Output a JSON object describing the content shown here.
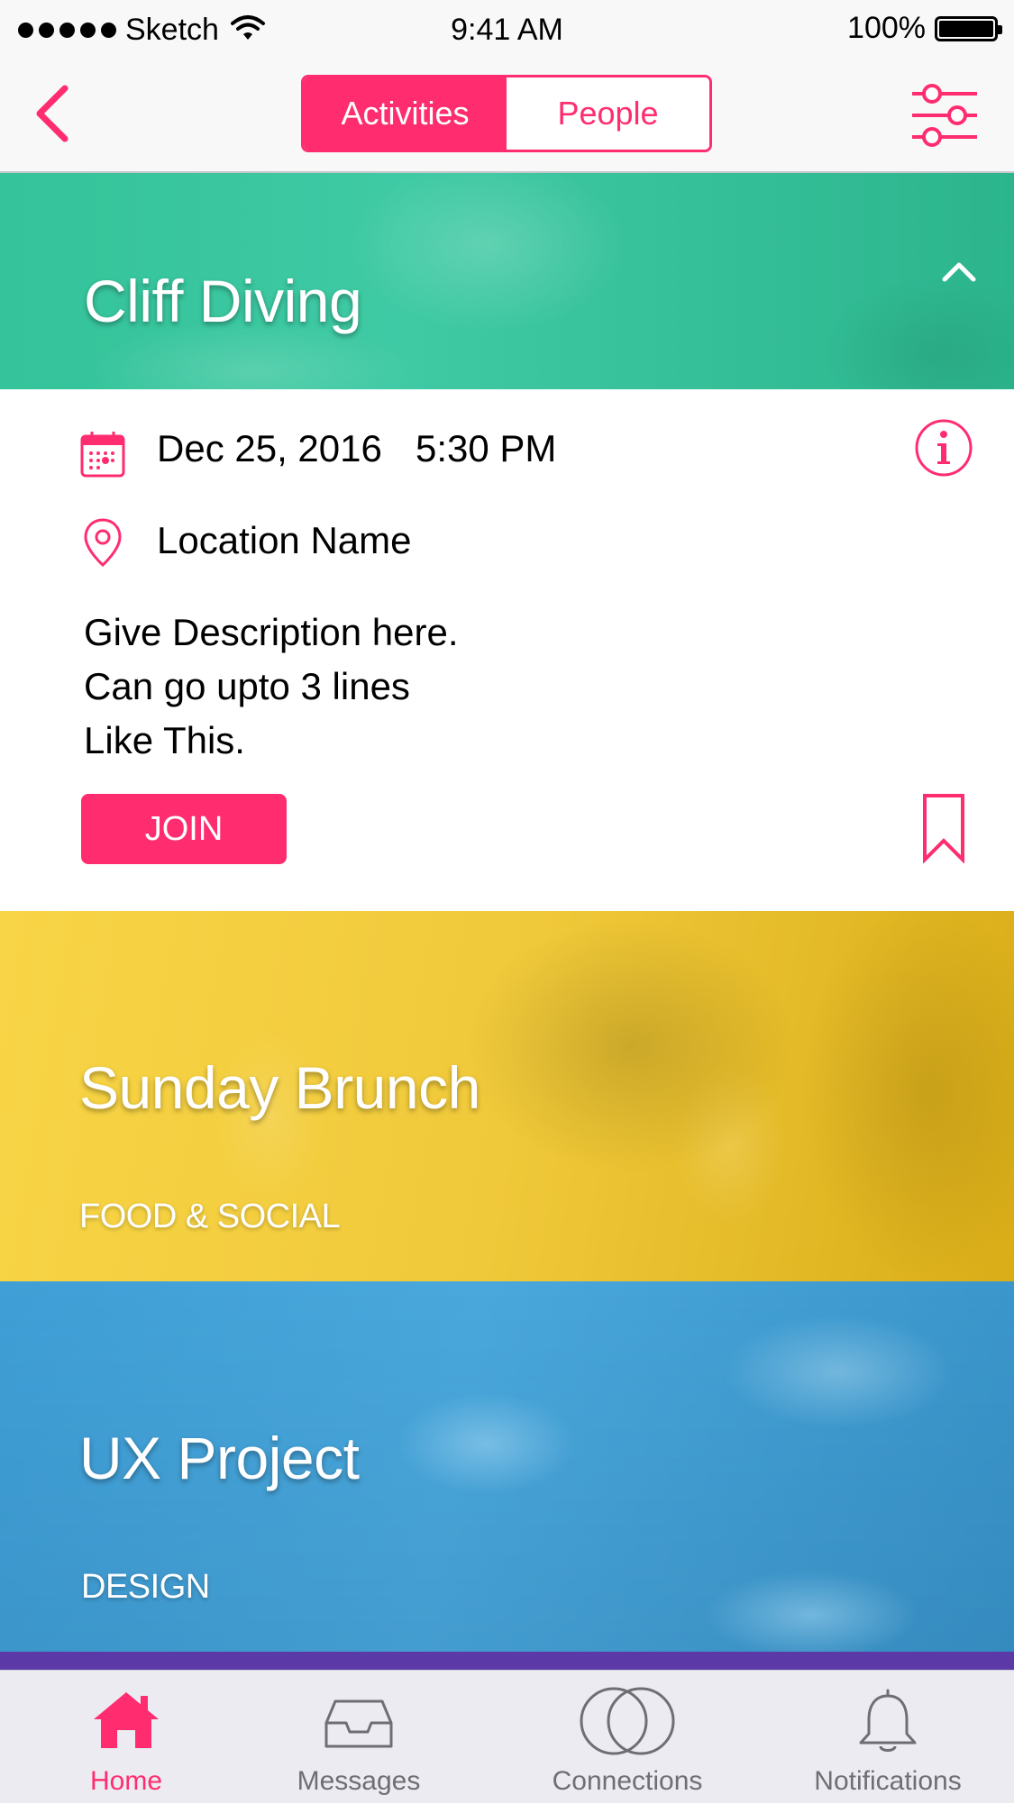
{
  "status_bar": {
    "carrier": "Sketch",
    "time": "9:41 AM",
    "battery": "100%"
  },
  "nav": {
    "segments": [
      {
        "label": "Activities",
        "active": true
      },
      {
        "label": "People",
        "active": false
      }
    ],
    "icons": {
      "back": "chevron-left-icon",
      "filter": "sliders-icon"
    }
  },
  "activities": [
    {
      "title": "Cliff Diving",
      "expanded": true,
      "color": "#34c39a",
      "date": "Dec 25, 2016",
      "time": "5:30 PM",
      "location": "Location Name",
      "description": [
        "Give Description here.",
        "Can go upto 3 lines",
        "Like This."
      ],
      "join_label": "JOIN"
    },
    {
      "title": "Sunday Brunch",
      "category": "FOOD & SOCIAL",
      "color": "#f0c93a"
    },
    {
      "title": "UX Project",
      "category": "DESIGN",
      "color": "#4aa8dc"
    }
  ],
  "tab_bar": {
    "tabs": [
      {
        "label": "Home",
        "icon": "home-icon",
        "active": true
      },
      {
        "label": "Messages",
        "icon": "inbox-icon",
        "active": false
      },
      {
        "label": "Connections",
        "icon": "connections-icon",
        "active": false
      },
      {
        "label": "Notifications",
        "icon": "bell-icon",
        "active": false
      }
    ]
  },
  "colors": {
    "accent": "#ff2d6f",
    "tab_inactive": "#6e6e73"
  }
}
